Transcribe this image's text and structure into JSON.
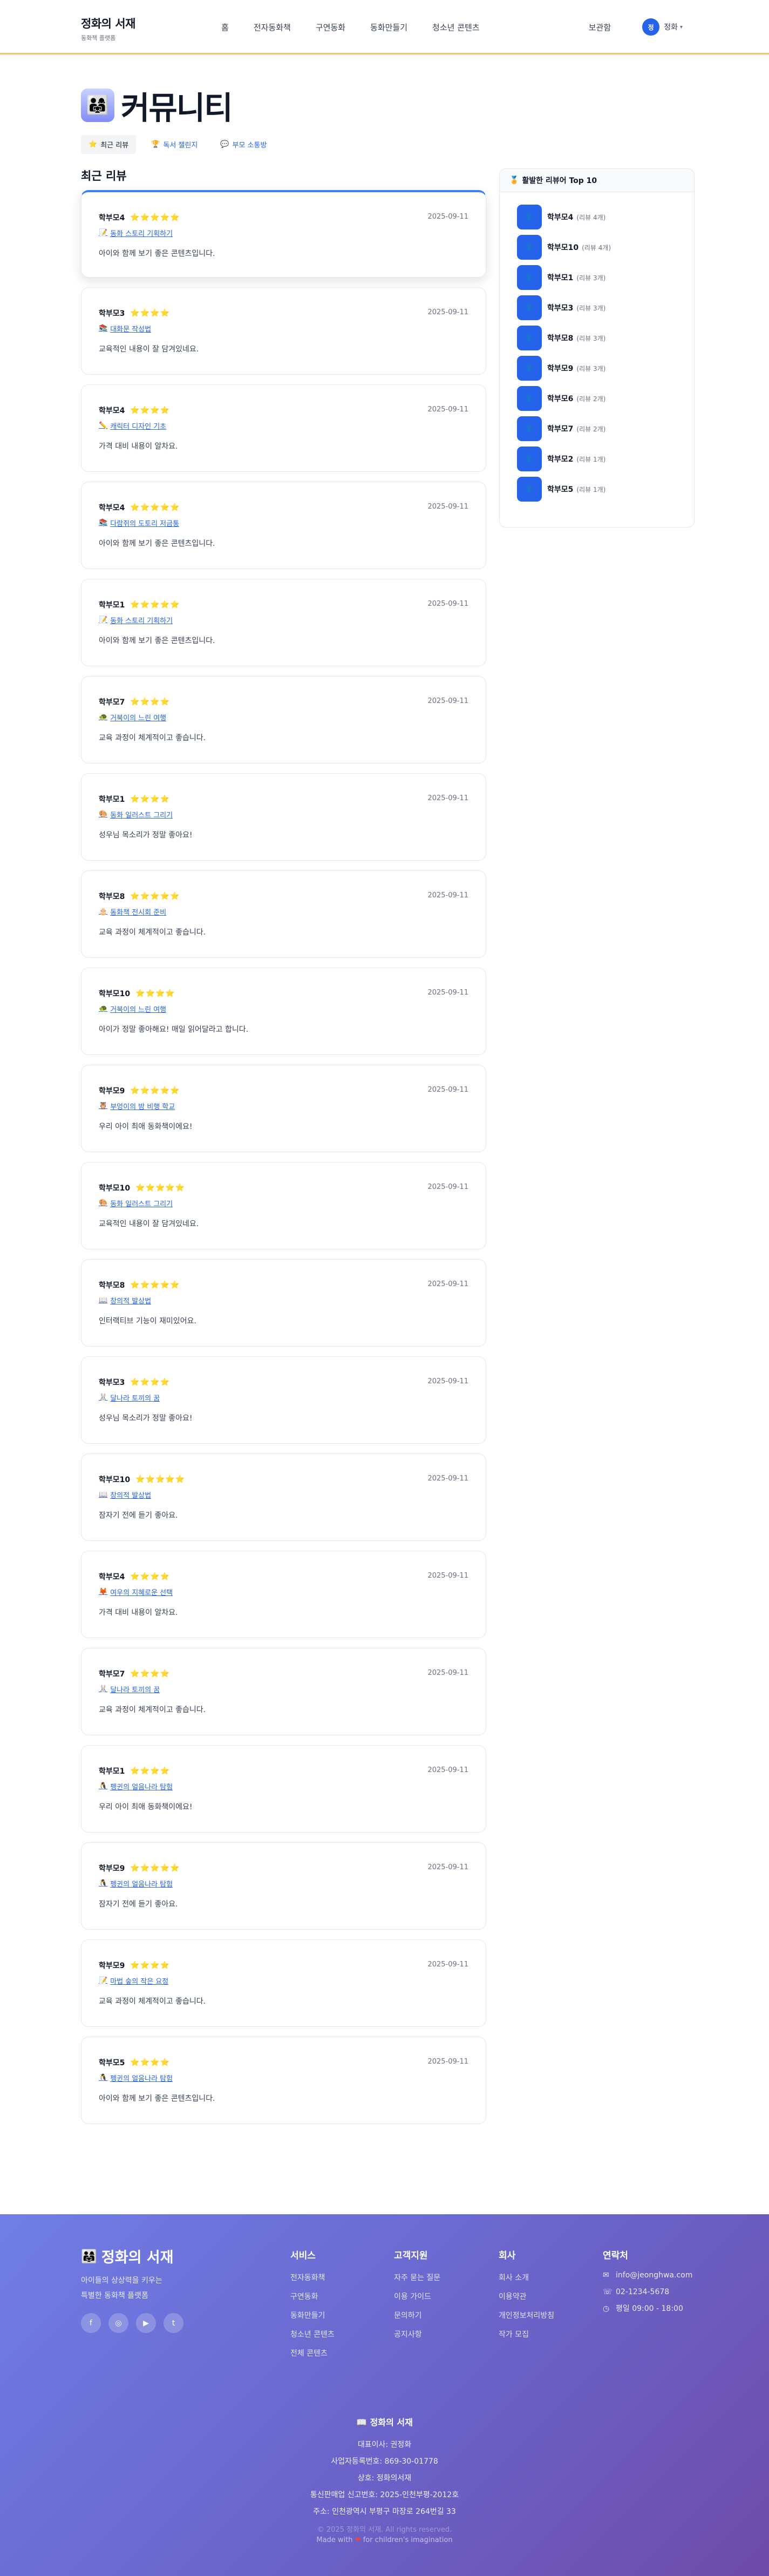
{
  "header": {
    "brand_title": "정화의 서재",
    "brand_sub": "동화책 플랫폼",
    "nav": [
      "홈",
      "전자동화책",
      "구연동화",
      "동화만들기",
      "청소년 콘텐츠"
    ],
    "library": "보관함",
    "avatar_initial": "정",
    "user_name": "정화",
    "caret": "▾"
  },
  "page": {
    "title_icon": "👨‍👩‍👧",
    "title": "커뮤니티",
    "tabs": [
      {
        "icon": "⭐",
        "label": "최근 리뷰"
      },
      {
        "icon": "🏆",
        "label": "독서 챌린지"
      },
      {
        "icon": "💬",
        "label": "부모 소통방"
      }
    ],
    "section_title": "최근 리뷰"
  },
  "reviews": [
    {
      "user": "학부모4",
      "stars": "⭐⭐⭐⭐⭐",
      "date": "2025-09-11",
      "book_icon": "📝",
      "book": "동화 스토리 기획하기",
      "text": "아이와 함께 보기 좋은 콘텐츠입니다."
    },
    {
      "user": "학부모3",
      "stars": "⭐⭐⭐⭐",
      "date": "2025-09-11",
      "book_icon": "📚",
      "book": "대화문 작성법",
      "text": "교육적인 내용이 잘 담겨있네요."
    },
    {
      "user": "학부모4",
      "stars": "⭐⭐⭐⭐",
      "date": "2025-09-11",
      "book_icon": "✏️",
      "book": "캐릭터 디자인 기초",
      "text": "가격 대비 내용이 알차요."
    },
    {
      "user": "학부모4",
      "stars": "⭐⭐⭐⭐⭐",
      "date": "2025-09-11",
      "book_icon": "📚",
      "book": "다람쥐의 도토리 저금통",
      "text": "아이와 함께 보기 좋은 콘텐츠입니다."
    },
    {
      "user": "학부모1",
      "stars": "⭐⭐⭐⭐⭐",
      "date": "2025-09-11",
      "book_icon": "📝",
      "book": "동화 스토리 기획하기",
      "text": "아이와 함께 보기 좋은 콘텐츠입니다."
    },
    {
      "user": "학부모7",
      "stars": "⭐⭐⭐⭐",
      "date": "2025-09-11",
      "book_icon": "🐢",
      "book": "거북이의 느린 여행",
      "text": "교육 과정이 체계적이고 좋습니다."
    },
    {
      "user": "학부모1",
      "stars": "⭐⭐⭐⭐",
      "date": "2025-09-11",
      "book_icon": "🎨",
      "book": "동화 일러스트 그리기",
      "text": "성우님 목소리가 정말 좋아요!"
    },
    {
      "user": "학부모8",
      "stars": "⭐⭐⭐⭐⭐",
      "date": "2025-09-11",
      "book_icon": "🎂",
      "book": "동화책 전시회 준비",
      "text": "교육 과정이 체계적이고 좋습니다."
    },
    {
      "user": "학부모10",
      "stars": "⭐⭐⭐⭐",
      "date": "2025-09-11",
      "book_icon": "🐢",
      "book": "거북이의 느린 여행",
      "text": "아이가 정말 좋아해요! 매일 읽어달라고 합니다."
    },
    {
      "user": "학부모9",
      "stars": "⭐⭐⭐⭐⭐",
      "date": "2025-09-11",
      "book_icon": "🦉",
      "book": "부엉이의 밤 비행 학교",
      "text": "우리 아이 최애 동화책이에요!"
    },
    {
      "user": "학부모10",
      "stars": "⭐⭐⭐⭐⭐",
      "date": "2025-09-11",
      "book_icon": "🎨",
      "book": "동화 일러스트 그리기",
      "text": "교육적인 내용이 잘 담겨있네요."
    },
    {
      "user": "학부모8",
      "stars": "⭐⭐⭐⭐⭐",
      "date": "2025-09-11",
      "book_icon": "📖",
      "book": "창의적 발상법",
      "text": "인터랙티브 기능이 재미있어요."
    },
    {
      "user": "학부모3",
      "stars": "⭐⭐⭐⭐",
      "date": "2025-09-11",
      "book_icon": "🐰",
      "book": "달나라 토끼의 꿈",
      "text": "성우님 목소리가 정말 좋아요!"
    },
    {
      "user": "학부모10",
      "stars": "⭐⭐⭐⭐⭐",
      "date": "2025-09-11",
      "book_icon": "📖",
      "book": "창의적 발상법",
      "text": "잠자기 전에 듣기 좋아요."
    },
    {
      "user": "학부모4",
      "stars": "⭐⭐⭐⭐",
      "date": "2025-09-11",
      "book_icon": "🦊",
      "book": "여우의 지혜로운 선택",
      "text": "가격 대비 내용이 알차요."
    },
    {
      "user": "학부모7",
      "stars": "⭐⭐⭐⭐",
      "date": "2025-09-11",
      "book_icon": "🐰",
      "book": "달나라 토끼의 꿈",
      "text": "교육 과정이 체계적이고 좋습니다."
    },
    {
      "user": "학부모1",
      "stars": "⭐⭐⭐⭐",
      "date": "2025-09-11",
      "book_icon": "🐧",
      "book": "펭귄의 얼음나라 탐험",
      "text": "우리 아이 최애 동화책이에요!"
    },
    {
      "user": "학부모9",
      "stars": "⭐⭐⭐⭐⭐",
      "date": "2025-09-11",
      "book_icon": "🐧",
      "book": "펭귄의 얼음나라 탐험",
      "text": "잠자기 전에 듣기 좋아요."
    },
    {
      "user": "학부모9",
      "stars": "⭐⭐⭐⭐",
      "date": "2025-09-11",
      "book_icon": "📝",
      "book": "마법 숲의 작은 요정",
      "text": "교육 과정이 체계적이고 좋습니다."
    },
    {
      "user": "학부모5",
      "stars": "⭐⭐⭐⭐",
      "date": "2025-09-11",
      "book_icon": "🐧",
      "book": "펭귄의 얼음나라 탐험",
      "text": "아이와 함께 보기 좋은 콘텐츠입니다."
    }
  ],
  "sidebar": {
    "icon": "🏅",
    "title": "활발한 리뷰어 Top 10",
    "avatar_glyph": "👤",
    "ranking": [
      {
        "name": "학부모4",
        "count": "(리뷰 4개)"
      },
      {
        "name": "학부모10",
        "count": "(리뷰 4개)"
      },
      {
        "name": "학부모1",
        "count": "(리뷰 3개)"
      },
      {
        "name": "학부모3",
        "count": "(리뷰 3개)"
      },
      {
        "name": "학부모8",
        "count": "(리뷰 3개)"
      },
      {
        "name": "학부모9",
        "count": "(리뷰 3개)"
      },
      {
        "name": "학부모6",
        "count": "(리뷰 2개)"
      },
      {
        "name": "학부모7",
        "count": "(리뷰 2개)"
      },
      {
        "name": "학부모2",
        "count": "(리뷰 1개)"
      },
      {
        "name": "학부모5",
        "count": "(리뷰 1개)"
      }
    ]
  },
  "footer": {
    "brand_icon": "👨‍👩‍👧",
    "brand_title": "정화의 서재",
    "tagline_1": "아이들의 상상력을 키우는",
    "tagline_2": "특별한 동화책 플랫폼",
    "socials": [
      "f",
      "◎",
      "▶",
      "t"
    ],
    "columns": [
      {
        "title": "서비스",
        "items": [
          "전자동화책",
          "구연동화",
          "동화만들기",
          "청소년 콘텐츠",
          "전체 콘텐츠"
        ]
      },
      {
        "title": "고객지원",
        "items": [
          "자주 묻는 질문",
          "이용 가이드",
          "문의하기",
          "공지사항"
        ]
      },
      {
        "title": "회사",
        "items": [
          "회사 소개",
          "이용약관",
          "개인정보처리방침",
          "작가 모집"
        ]
      }
    ],
    "contact": {
      "title": "연락처",
      "email_icon": "✉",
      "email": "info@jeonghwa.com",
      "phone_icon": "☏",
      "phone": "02-1234-5678",
      "hours_icon": "◷",
      "hours": "평일 09:00 - 18:00"
    },
    "bottom": {
      "icon": "📖",
      "title": "정화의 서재",
      "lines": [
        "대표이사: 권정화",
        "사업자등록번호: 869-30-01778",
        "상호: 정화의서재",
        "통신판매업 신고번호: 2025-인천부평-2012호",
        "주소: 인천광역시 부평구 마장로 264번길 33"
      ],
      "copyright": "© 2025 정화의 서재. All rights reserved.",
      "made_prefix": "Made with",
      "heart": "❤",
      "made_suffix": "for children's imagination"
    }
  }
}
